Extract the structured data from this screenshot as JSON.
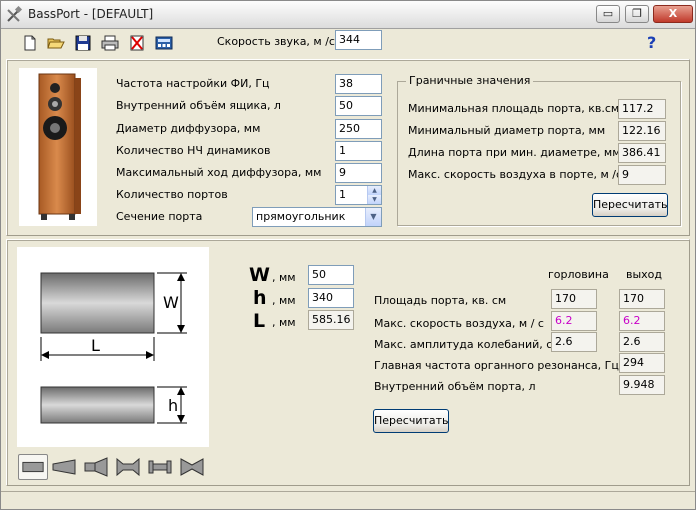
{
  "window": {
    "title": "BassPort - [DEFAULT]",
    "minimize_glyph": "▭",
    "restore_glyph": "❐",
    "close_glyph": "X"
  },
  "toolbar": {
    "icons": [
      "new-file-icon",
      "open-folder-icon",
      "save-icon",
      "print-icon",
      "delete-icon",
      "calculator-icon"
    ],
    "sound_speed_label": "Скорость звука, м /с",
    "sound_speed_value": "344",
    "help_glyph": "?"
  },
  "params": {
    "tuning_freq": {
      "label": "Частота настройки ФИ, Гц",
      "value": "38"
    },
    "box_volume": {
      "label": "Внутренний объём ящика, л",
      "value": "50"
    },
    "cone_diameter": {
      "label": "Диаметр диффузора, мм",
      "value": "250"
    },
    "woofers_count": {
      "label": "Количество НЧ динамиков",
      "value": "1"
    },
    "max_excursion": {
      "label": "Максимальный ход диффузора, мм",
      "value": "9"
    },
    "ports_count": {
      "label": "Количество портов",
      "value": "1"
    },
    "port_section": {
      "label": "Сечение порта",
      "value": "прямоугольник"
    }
  },
  "limits": {
    "title": "Граничные значения",
    "min_area": {
      "label": "Минимальная площадь порта, кв.см.",
      "value": "117.2"
    },
    "min_diameter": {
      "label": "Минимальный диаметр порта, мм",
      "value": "122.16"
    },
    "length_min_diam": {
      "label": "Длина порта при мин. диаметре, мм",
      "value": "386.41"
    },
    "max_air_speed": {
      "label": "Макс. скорость воздуха в порте, м /с",
      "value": "9"
    },
    "recalc_label": "Пересчитать"
  },
  "dims": {
    "w_letter": "W",
    "h_letter": "h",
    "l_letter": "L",
    "unit": ", мм",
    "w_value": "50",
    "h_value": "340",
    "l_value": "585.16"
  },
  "diagram": {
    "w_label": "W",
    "l_label": "L",
    "h_label": "h"
  },
  "results": {
    "col_throat": "горловина",
    "col_exit": "выход",
    "area": {
      "label": "Площадь порта, кв. см",
      "throat": "170",
      "exit": "170"
    },
    "air_speed": {
      "label": "Макс. скорость воздуха, м / с",
      "throat": "6.2",
      "exit": "6.2"
    },
    "amplitude": {
      "label": "Макс. амплитуда колебаний, см",
      "throat": "2.6",
      "exit": "2.6"
    },
    "organ_freq": {
      "label": "Главная частота органного резонанса, Гц",
      "value": "294"
    },
    "port_volume": {
      "label": "Внутренний объём порта, л",
      "value": "9.948"
    },
    "recalc_label": "Пересчитать"
  },
  "port_shapes": [
    "straight-port-icon",
    "flared-port-icon",
    "horn-port-icon",
    "double-flared-port-icon",
    "bowtie-port-icon",
    "hourglass-port-icon"
  ],
  "colors": {
    "magenta_value": "#c800c8",
    "window_bg": "#ece9d8",
    "help_blue": "#1a3fb5",
    "speaker_wood": "#c8743a"
  }
}
